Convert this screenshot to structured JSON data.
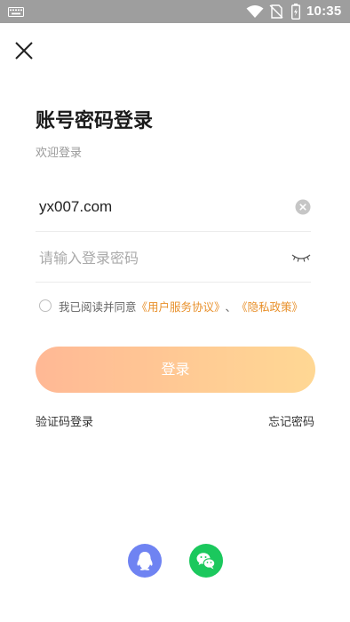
{
  "status_bar": {
    "time": "10:35",
    "icons": [
      "keyboard-icon",
      "wifi-icon",
      "no-sim-icon",
      "battery-charging-icon"
    ]
  },
  "header": {
    "close_icon": "close-icon"
  },
  "login": {
    "title": "账号密码登录",
    "subtitle": "欢迎登录",
    "account_value": "yx007.com",
    "password_placeholder": "请输入登录密码",
    "agreement_prefix": "我已阅读并同意",
    "user_agreement_link": "《用户服务协议》",
    "agreement_separator": "、",
    "privacy_policy_link": "《隐私政策》",
    "login_button": "登录",
    "sms_login": "验证码登录",
    "forgot_password": "忘记密码"
  },
  "social_login": [
    {
      "name": "QQ",
      "icon": "qq-icon",
      "color": "#6f83f2"
    },
    {
      "name": "WeChat",
      "icon": "wechat-icon",
      "color": "#1bc85d"
    }
  ]
}
